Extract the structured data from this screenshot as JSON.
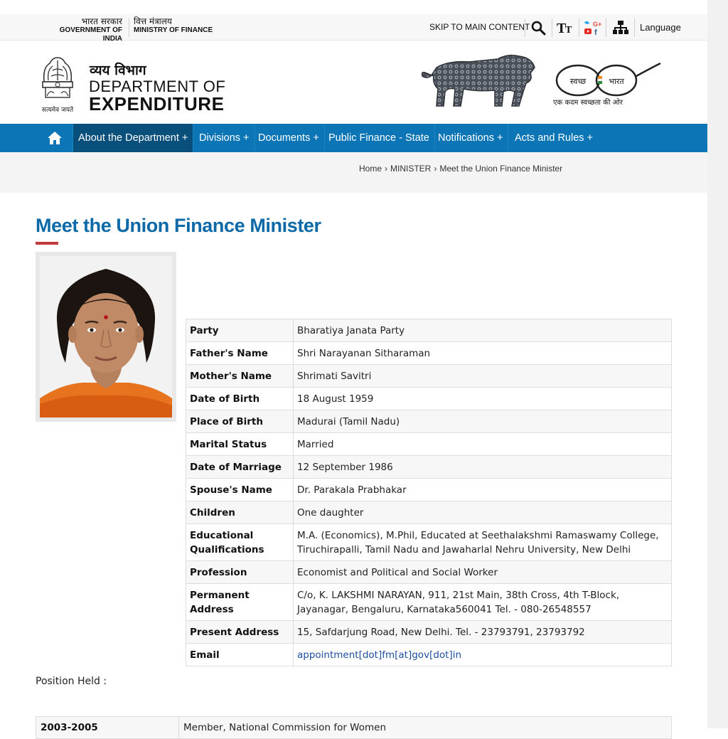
{
  "topbar": {
    "gov_india_hi": "भारत सरकार",
    "gov_india_en": "GOVERNMENT OF INDIA",
    "ministry_hi": "वित्त मंत्रालय",
    "ministry_en": "MINISTRY OF FINANCE",
    "skip_link": "SKIP TO MAIN CONTENT",
    "language": "Language",
    "icons": [
      "search-icon",
      "text-size-icon",
      "social-media-icon",
      "sitemap-icon"
    ]
  },
  "brand": {
    "emblem_motto": "सत्यमेव जयते",
    "dept_hi": "व्यय विभाग",
    "dept_en_line1": "DEPARTMENT OF",
    "dept_en_line2": "EXPENDITURE",
    "swachh_left": "स्वच्छ",
    "swachh_right": "भारत",
    "swachh_tagline": "एक कदम स्वच्छता की ओर"
  },
  "nav": {
    "items": [
      {
        "label": "About the Department +"
      },
      {
        "label": "Divisions +"
      },
      {
        "label": "Documents +"
      },
      {
        "label": "Public Finance - State"
      },
      {
        "label": "Notifications +"
      },
      {
        "label": "Acts and Rules +"
      }
    ]
  },
  "breadcrumb": [
    "Home",
    "MINISTER",
    "Meet the Union Finance Minister"
  ],
  "page_title": "Meet the Union Finance Minister",
  "profile": [
    {
      "key": "Party",
      "value": "Bharatiya Janata Party"
    },
    {
      "key": "Father's Name",
      "value": "Shri Narayanan Sitharaman"
    },
    {
      "key": "Mother's Name",
      "value": "Shrimati Savitri"
    },
    {
      "key": "Date of Birth",
      "value": "18 August 1959"
    },
    {
      "key": "Place of Birth",
      "value": "Madurai (Tamil Nadu)"
    },
    {
      "key": "Marital Status",
      "value": "Married"
    },
    {
      "key": "Date of Marriage",
      "value": "12 September 1986"
    },
    {
      "key": "Spouse's Name",
      "value": "Dr. Parakala Prabhakar"
    },
    {
      "key": "Children",
      "value": "One daughter"
    },
    {
      "key": "Educational Qualifications",
      "value": "M.A. (Economics), M.Phil, Educated at Seethalakshmi Ramaswamy College, Tiruchirapalli, Tamil Nadu and Jawaharlal Nehru University, New Delhi"
    },
    {
      "key": "Profession",
      "value": "Economist and Political and Social Worker"
    },
    {
      "key": "Permanent Address",
      "value": "C/o, K. LAKSHMI NARAYAN, 911, 21st Main, 38th Cross, 4th T-Block, Jayanagar, Bengaluru, Karnataka560041 Tel. - 080-26548557"
    },
    {
      "key": "Present Address",
      "value": "15, Safdarjung Road, New Delhi. Tel. - 23793791, 23793792"
    },
    {
      "key": "Email",
      "value": "appointment[dot]fm[at]gov[dot]in"
    }
  ],
  "position_label": "Position Held :",
  "positions": [
    {
      "year": "2003-2005",
      "role": "Member, National Commission for Women"
    }
  ],
  "colors": {
    "nav_bg": "#0b75b5",
    "nav_active": "#084f7c",
    "title": "#0b69a8",
    "accent_rule": "#c33a3a",
    "link": "#1d4ea0"
  }
}
